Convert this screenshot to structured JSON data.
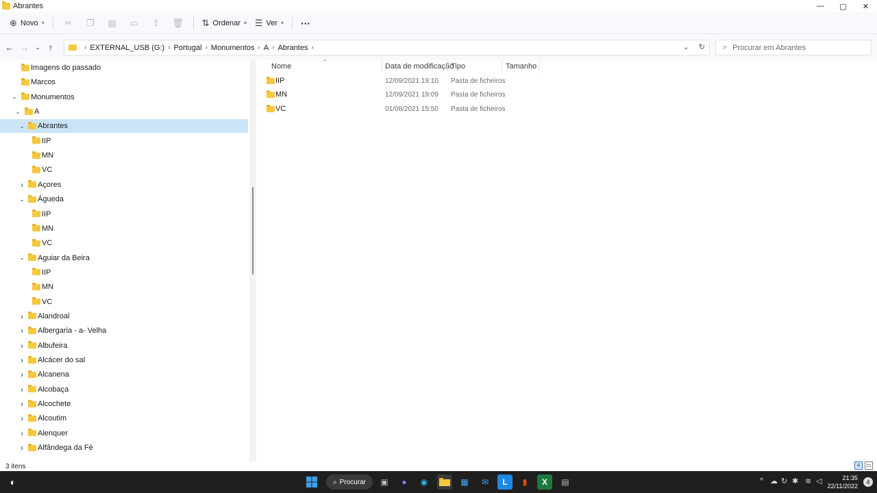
{
  "window": {
    "title": "Abrantes",
    "minimize": "—",
    "maximize": "▢",
    "close": "✕"
  },
  "toolbar": {
    "new_label": "Novo",
    "sort_label": "Ordenar",
    "view_label": "Ver",
    "more": "···"
  },
  "address": {
    "crumbs": [
      "EXTERNAL_USB (G:)",
      "Portugal",
      "Monumentos",
      "A",
      "Abrantes"
    ]
  },
  "search": {
    "placeholder": "Procurar em Abrantes"
  },
  "tree": [
    {
      "label": "Imagens do passado",
      "indent": 0,
      "chevron": ""
    },
    {
      "label": "Marcos",
      "indent": 0,
      "chevron": ""
    },
    {
      "label": "Monumentos",
      "indent": 0,
      "chevron": "expanded"
    },
    {
      "label": "A",
      "indent": 1,
      "chevron": "expanded"
    },
    {
      "label": "Abrantes",
      "indent": 2,
      "chevron": "expanded",
      "selected": true
    },
    {
      "label": "IIP",
      "indent": 3,
      "chevron": ""
    },
    {
      "label": "MN",
      "indent": 3,
      "chevron": ""
    },
    {
      "label": "VC",
      "indent": 3,
      "chevron": ""
    },
    {
      "label": "Açores",
      "indent": 2,
      "chevron": "collapsed"
    },
    {
      "label": "Águeda",
      "indent": 2,
      "chevron": "expanded"
    },
    {
      "label": "IIP",
      "indent": 3,
      "chevron": ""
    },
    {
      "label": "MN",
      "indent": 3,
      "chevron": ""
    },
    {
      "label": "VC",
      "indent": 3,
      "chevron": ""
    },
    {
      "label": "Aguiar da Beira",
      "indent": 2,
      "chevron": "expanded"
    },
    {
      "label": "IIP",
      "indent": 3,
      "chevron": ""
    },
    {
      "label": "MN",
      "indent": 3,
      "chevron": ""
    },
    {
      "label": "VC",
      "indent": 3,
      "chevron": ""
    },
    {
      "label": "Alandroal",
      "indent": 2,
      "chevron": "collapsed"
    },
    {
      "label": "Albergaria - a- Velha",
      "indent": 2,
      "chevron": "collapsed"
    },
    {
      "label": "Albufeira",
      "indent": 2,
      "chevron": "collapsed"
    },
    {
      "label": "Alcácer do sal",
      "indent": 2,
      "chevron": "collapsed"
    },
    {
      "label": "Alcanena",
      "indent": 2,
      "chevron": "collapsed"
    },
    {
      "label": "Alcobaça",
      "indent": 2,
      "chevron": "collapsed"
    },
    {
      "label": "Alcochete",
      "indent": 2,
      "chevron": "collapsed"
    },
    {
      "label": "Alcoutim",
      "indent": 2,
      "chevron": "collapsed"
    },
    {
      "label": "Alenquer",
      "indent": 2,
      "chevron": "collapsed"
    },
    {
      "label": "Alfândega da Fé",
      "indent": 2,
      "chevron": "collapsed"
    }
  ],
  "columns": {
    "name": "Nome",
    "date": "Data de modificação",
    "type": "Tipo",
    "size": "Tamanho"
  },
  "files": [
    {
      "name": "IIP",
      "date": "12/09/2021 19:10",
      "type": "Pasta de ficheiros"
    },
    {
      "name": "MN",
      "date": "12/09/2021 19:09",
      "type": "Pasta de ficheiros"
    },
    {
      "name": "VC",
      "date": "01/08/2021 15:50",
      "type": "Pasta de ficheiros"
    }
  ],
  "status": {
    "count": "3 itens"
  },
  "taskbar": {
    "search_label": "Procurar",
    "time": "21:35",
    "date": "22/11/2022",
    "notifications": "4"
  }
}
